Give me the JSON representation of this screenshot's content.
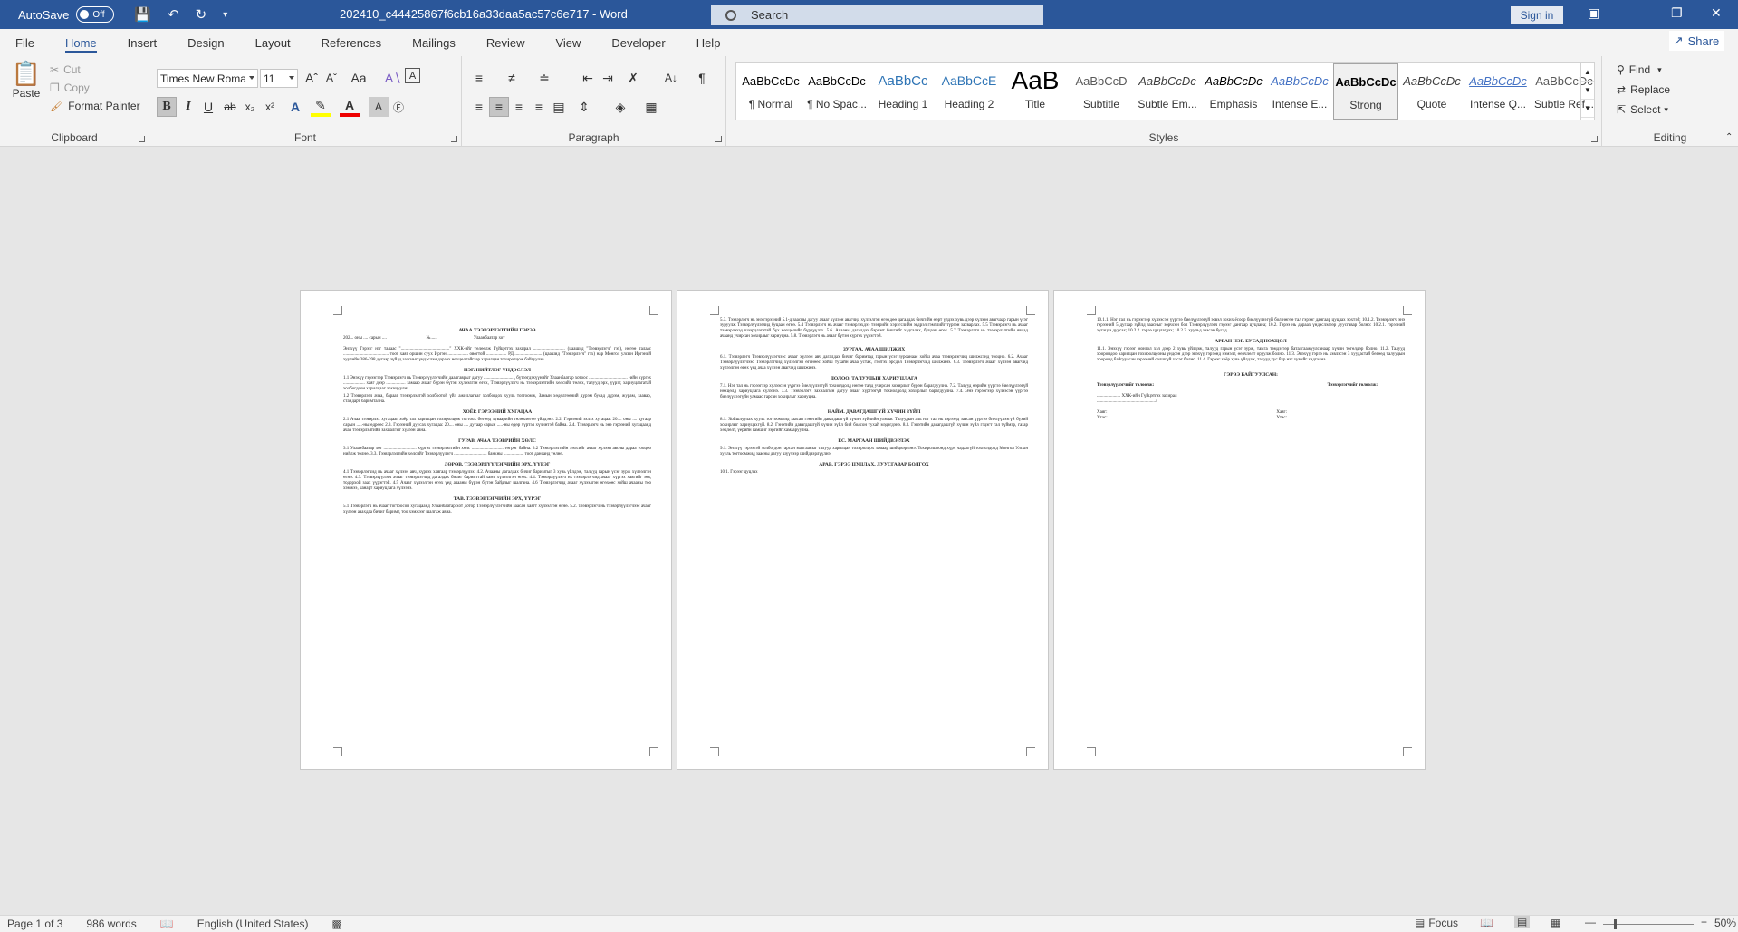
{
  "titlebar": {
    "autosave_label": "AutoSave",
    "autosave_state": "Off",
    "doc_title": "202410_c44425867f6cb16a33daa5ac57c6e717 - Word",
    "search_placeholder": "Search",
    "signin_label": "Sign in"
  },
  "tabs": [
    "File",
    "Home",
    "Insert",
    "Design",
    "Layout",
    "References",
    "Mailings",
    "Review",
    "View",
    "Developer",
    "Help"
  ],
  "active_tab": "Home",
  "share_label": "Share",
  "clipboard": {
    "paste": "Paste",
    "cut": "Cut",
    "copy": "Copy",
    "format_painter": "Format Painter",
    "label": "Clipboard"
  },
  "font": {
    "name": "Times New Roma",
    "size": "11",
    "label": "Font"
  },
  "paragraph": {
    "label": "Paragraph"
  },
  "styles": {
    "label": "Styles",
    "items": [
      {
        "preview": "AaBbCcDc",
        "name": "¶ Normal"
      },
      {
        "preview": "AaBbCcDc",
        "name": "¶ No Spac..."
      },
      {
        "preview": "AaBbCc",
        "name": "Heading 1"
      },
      {
        "preview": "AaBbCcE",
        "name": "Heading 2"
      },
      {
        "preview": "AaB",
        "name": "Title"
      },
      {
        "preview": "AaBbCcD",
        "name": "Subtitle"
      },
      {
        "preview": "AaBbCcDc",
        "name": "Subtle Em..."
      },
      {
        "preview": "AaBbCcDc",
        "name": "Emphasis"
      },
      {
        "preview": "AaBbCcDc",
        "name": "Intense E..."
      },
      {
        "preview": "AaBbCcDc",
        "name": "Strong"
      },
      {
        "preview": "AaBbCcDc",
        "name": "Quote"
      },
      {
        "preview": "AaBbCcDc",
        "name": "Intense Q..."
      },
      {
        "preview": "AaBbCcDc",
        "name": "Subtle Ref..."
      }
    ]
  },
  "editing": {
    "find": "Find",
    "replace": "Replace",
    "select": "Select",
    "label": "Editing"
  },
  "pages": {
    "p1": {
      "title": "АЧАА ТЭЭВЭРЛЭЛТИЙН ГЭРЭЭ",
      "dateline": "202... оны .... сарын ....                                   №.....                                 Улаанбаатар хот",
      "intro": "Энэхүү Гэрээг нэг талаас \"...........................................\" ХХК-ийг төлөөлж Гүйцэтгэх захирал ............................ (цаашид \"Тээвэрлэгч\" гэх), нөгөө талаас ........................................ тоот хаяг оршин суух Иргэн .................. овогтой .................. РД:........................ (цаашид \"Тээвэрлэгч\" гэх) нар Монгол улсын Иргэний хуулийн 386-398 дугаар зүйлд заасныг үндэслэн дараах нөхцөлтэйгээр харилцан тохиролцож байгуулав.",
      "h1": "НЭГ. НИЙТЛЭГ ҮНДЭСЛЭЛ",
      "s1": "1.1 Энэхүү гэрээгээр Тээвэрлэгч нь Тээвэрлүүлэгчийн даалгаврыг дагуу .......................... , бүтээгдэхүүнийг Улаанбаатар хотоос .................................. -ийн хүргэх ................... хаяг дээр ................. замаар ачааг бүрэн бүтэн хүлээлгэн өгөх, Тээвэрлүүлэгч нь тээвэрлэлтийн хөлсийг төлөх, талууд эрх, үүрэг, хариуцлагатай холбогдсон харилцааг зохицуулна.",
      "s1b": "1.2 Тээвэрлэгч ачаа, барааг тээвэрлэлтэй холбоотой үйл ажиллагааг холбогдох хууль тогтоомж, Замын хөдөлгөөний дүрэм бусад дүрэм, журам, заавар, стандарт баримтална.",
      "h2": "ХОЁР. ГЭРЭЭНИЙ ХУГАЦАА",
      "s2": "2.1 Ачаа тээвэрлэх хугацааг хоёр тал харилцан тохиролцож тогтоох бөгөөд хуваарийн төлөвлөгөө үйлдэнэ. 2.2. Гэрээний эхлэх хугацаа: 20.... оны .... дугаар сарын .....-ны өдрөөс 2.3. Гэрээний дуусах хугацаа: 20.... оны .... дугаар сарын .....-ны өдөр хүртэл хүчинтэй байна. 2.4. Тээвэрлэгч нь энэ гэрээний хугацаанд ачаа тээвэрлэлтийн захиалгыг хүлээн авна.",
      "h3": "ГУРАВ. АЧАА ТЭЭВРИЙН ХӨЛС",
      "s3": "3.1 Улаанбаатар хот ............................. хүргэх тээвэрлэлтийн хөлс ............................ төгрөг байна. 3.2 Тээвэрлэлтийн хөлсийг ачааг хүлээн авсны дараа тооцоо нийлж төлнө. 3.3. Тээвэрлэлтийн хөлсийг Тээвэрлүүлэгч ............................. банкны .................. тоот дансанд төлнө.",
      "h4": "ДӨРӨВ. ТЭЭВЭРЛҮҮЛЭГЧИЙН ЭРХ, ҮҮРЭГ",
      "s4": "4.1 Тээвэрлэгчид нь ачааг хүлээн авч, хүргэх хаягаар тээвэрлүүлэх. 4.2. Ачааны дагалдах бичиг баримтыг 3 хувь үйлдэж, талууд гарын үсэг зурж хүлээлгэн өгнө. 4.3. Тээвэрлүүлэгч ачааг тээвэрлэгчид дагалдах бичиг баримттай хамт хүлээлгэн өгөх. 4.4. Тээвэрлүүлэгч нь тээвэрлэгчид ачааг хүргэх хаягийг зөв, тодорхой заах үүрэгтэй. 4.5 Ачааг хүлээлгэн өгөх үед ачааны бүрэн бүтэн байдлыг шалгана. 4.6 Тээвэрлэгчид ачааг хүлээлгэн өгөхөөс хойш ачааны тоо хэмжээ, чанарт хариуцлага хүлээнэ.",
      "h5": "ТАВ. ТЭЭВЭРЛЭГЧИЙН ЭРХ, ҮҮРЭГ",
      "s5": "5.1 Тээвэрлэгч нь ачааг тогтоосон хугацаанд Улаанбаатар хот дотор Тээвэрлүүлэгчийн заасан хаягт хүлээлгэн өгнө. 5.2. Тээвэрлэгч нь тээвэрлүүлэгчээс ачааг хүлээн авахдаа бичиг баримт, тоо хэмжээг шалгаж авна."
    },
    "p2": {
      "s5b": "5.3. Тээвэрлэгч нь энэ гэрээний 5.1-д заасны дагуу ачааг хүлээн авагчид хүлээлгэн өгөхдөө дагалдах бичгийн өөрт үлдэх хувь дээр хүлээн авагчаар гарын үсэг зуруулж Тээвэрлүүлэгчид буцаан өгнө. 5.4 Тээвэрлэгч нь ачааг тээвэрлэхдээ тээврийн хэрэгслийн эвдрэл гэмтлийг түргэн засварлах. 5.5 Тээвэрлэгч нь ачааг тээвэрлэхэд шаардлагатай бүх нөхцөлийг бүрдүүлэх. 5.6. Ачааны дагалдах баримт бичгийг хадгалах, буцаан өгөх. 5.7 Тээвэрлэгч нь тээвэрлэлтийн явцад ачаанд учирсан хохирлыг хариуцна. 5.8. Тээвэрлэгч нь ачааг бүтэн хүргэх үүрэгтэй.",
      "h6": "ЗУРГАА. АЧАА ШИЛЖИХ",
      "s6": "6.1. Тээвэрлэгч Тээвэрлүүлэгчээс ачааг хүлээн авч дагалдах бичиг баримтад гарын үсэг зурсанаас хойш ачаа тээвэрлэгчид шилжсэнд тооцно. 6.2. Ачааг Тээвэрлүүлэгчээс Тээвэрлэгчид хүлээлгэн өгснөөс хойш тухайн ачаа устах, гэмтэх эрсдэл Тээвэрлэгчид шилжинэ. 6.3. Тээвэрлэгч ачааг хүлээн авагчид хүлээлгэн өгөх үед ачаа хүлээн авагчид шилжинэ.",
      "h7": "ДОЛОО. ТАЛУУДЫН ХАРИУЦЛАГА",
      "s7": "7.1. Нэг тал нь гэрээгээр хүлээсэн үүргээ биелүүлээгүй тохиолдолд нөгөө талд учирсан хохирлыг бүрэн барагдуулна. 7.2. Талууд өөрийн үүргээ биелүүлээгүй нөхцөлд хариуцлага хүлээнэ. 7.3. Тээвэрлэгч захиалгын дагуу ачааг хүргээгүй тохиолдолд хохирлыг барагдуулна. 7.4. Энэ гэрээгээр хүлээсэн үүргээ биелүүлээгүйн улмаас гарсан хохирлыг хариуцна.",
      "h8": "НАЙМ. ДАВАГДАШГҮЙ ХҮЧИН ЗҮЙЛ",
      "s8": "8.1. Хойшлуулах хууль тогтоомжид заасан гэнэтийн давагдашгүй хүчин зүйлийн улмаас Талуудын аль нэг тал нь гэрээнд заасан үүргээ биелүүлээгүй бүхий хохирлыг хариуцахгүй. 8.2. Гэнэтийн давагдашгүй хүчин зүйл бий болсон тухай мэдэгдэнэ. 8.3. Гэнэтийн давагдашгүй хүчин зүйл гэдэгт гал түймэр, газар хөдлөлт, үерийн гамшиг зэргийг хамааруулна.",
      "h9": "ЕС. МАРГААН ШИЙДВЭРЛЭХ",
      "s9": "9.1. Энэхүү гэрээтэй холбогдон гарсан маргааныг талууд харилцан тохиролцох замаар шийдвэрлэнэ. Тохиролцоонд хүрч чадаагүй тохиолдолд Монгол Улсын хууль тогтоомжид заасны дагуу шүүхээр шийдвэрлүүлнэ.",
      "h10": "АРАВ. ГЭРЭЭ ЦУЦЛАХ, ДУУСГАВАР БОЛГОХ",
      "s10": "10.1. Гэрээг цуцлах"
    },
    "p3": {
      "s10b": "10.1.1. Нэг тал нь гэрээгээр хүлээсэн үүргээ биелүүлээгүй эсвэл зохих ёсоор биелүүлээгүй бол нөгөө тал гэрээг дангаар цуцлах эрхтэй; 10.1.2. Тээвэрлэгч энэ гэрээний 5 дугаар зүйлд заасныг зөрчсөн бол Тээвэрлүүлэгч гэрээг дангаар цуцлана; 10.2. Гэрээ нь дараах үндэслэлээр дуусгавар болно: 10.2.1. гэрээний хугацаа дуусах; 10.2.2. гэрээ цуцлагдах; 10.2.3. хуульд заасан бусад.",
      "h11": "АРВАН НЭГ. БУСАД НӨХЦӨЛ",
      "s11": "11.1. Энэхүү гэрээг монгол хэл дээр 2 хувь үйлдэж, талууд гарын үсэг зурж, тамга тэмдэгээр баталгаажуулсанаар хүчин төгөлдөр болно. 11.2. Талууд хоорондоо харилцан тохиролцсоны үндсэн дээр энэхүү гэрээнд нэмэлт, өөрчлөлт оруулж болно. 11.3. Энэхүү гэрээ нь хэвлэсэн 3 хуудастай бөгөөд талуудын хооронд байгуулсан гэрээний салшгүй хэсэг болно. 11.4. Гэрээг хоёр хувь үйлдэж, талууд тус бүр нэг хувийг хадгална.",
      "h12": "ГЭРЭЭ БАЙГУУЛСАН:",
      "sig_left": "Тээвэрлүүлэгчийг төлөөлж:",
      "sig_right": "Тээвэрлэгчийг төлөөлж:",
      "sig_company": "..................... ХХК-ийн Гүйцэтгэх захирал",
      "sig_line": "..................................................../",
      "addr_l": "Хаяг:",
      "phone_l": "Утас:",
      "addr_r": "Хаяг:",
      "phone_r": "Утас:"
    }
  },
  "status": {
    "page": "Page 1 of 3",
    "words": "986 words",
    "language": "English (United States)",
    "focus": "Focus",
    "zoom": "50%"
  }
}
